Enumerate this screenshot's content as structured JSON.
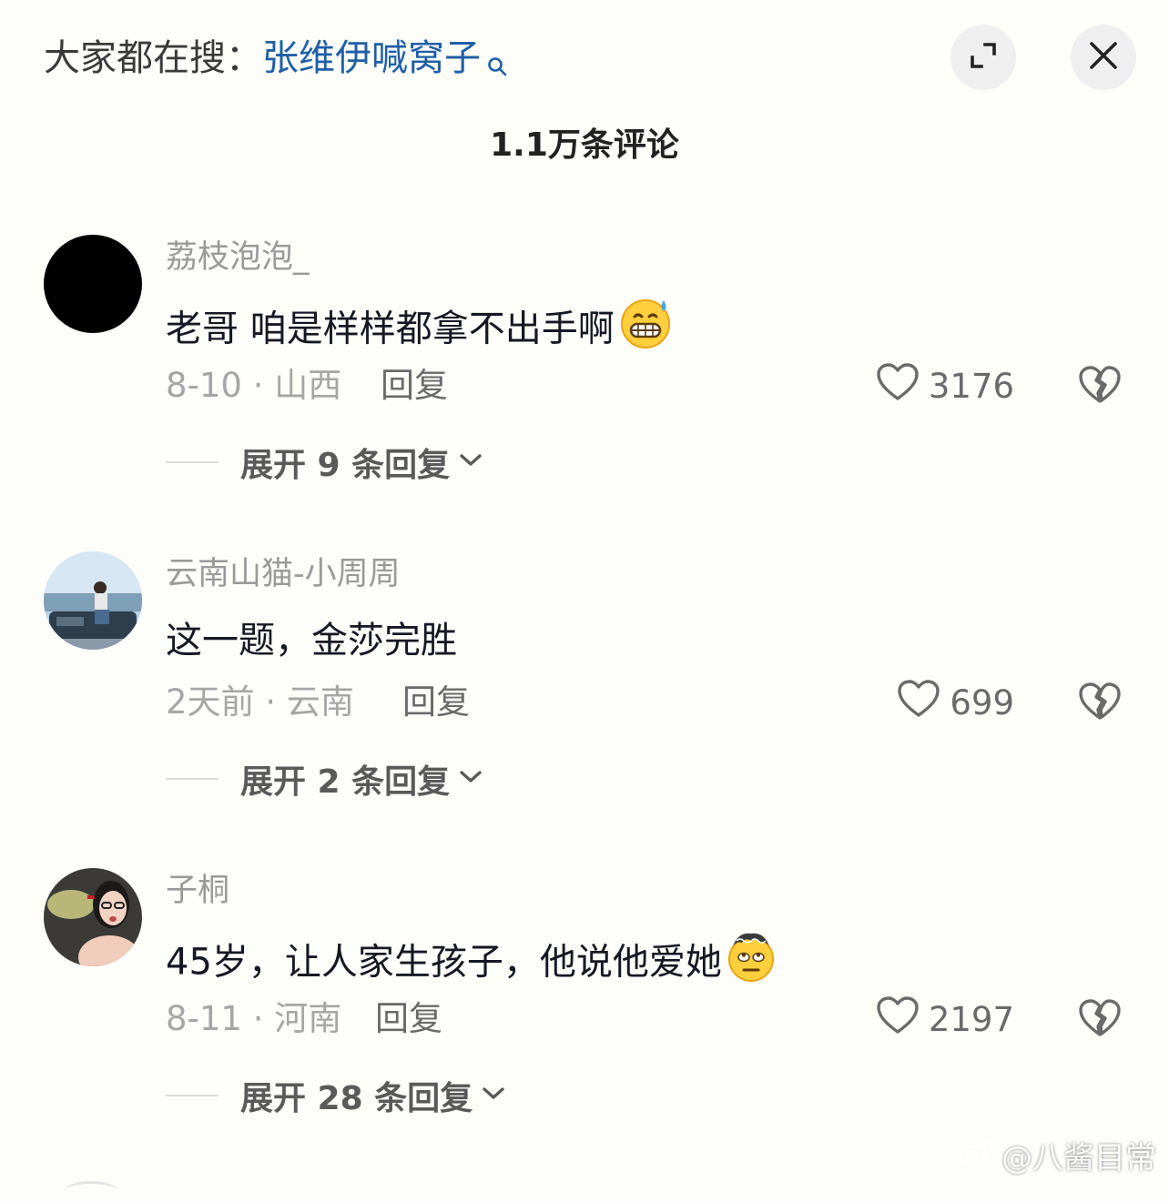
{
  "header": {
    "search_prefix": "大家都在搜：",
    "search_term": "张维伊喊窝子",
    "comment_count": "1.1万条评论"
  },
  "comments": [
    {
      "username": "荔枝泡泡_",
      "content": "老哥 咱是样样都拿不出手啊",
      "emoji": "grimace-sweat-emoji",
      "date_location": "8-10 · 山西",
      "reply_label": "回复",
      "likes": "3176",
      "expand_label": "展开 9 条回复"
    },
    {
      "username": "云南山猫-小周周",
      "content": "这一题，金莎完胜",
      "date_location": "2天前 · 云南",
      "reply_label": "回复",
      "likes": "699",
      "expand_label": "展开 2 条回复"
    },
    {
      "username": "子桐",
      "content": "45岁，让人家生孩子，他说他爱她",
      "emoji": "dizzy-eye-roll-emoji",
      "date_location": "8-11 · 河南",
      "reply_label": "回复",
      "likes": "2197",
      "expand_label": "展开 28 条回复"
    }
  ],
  "watermark": "@八酱目常",
  "colors": {
    "background": "#fdfdf9",
    "search_term": "#1f5fa6",
    "secondary_text": "#a6a6a6",
    "button_bg": "#efefef"
  }
}
